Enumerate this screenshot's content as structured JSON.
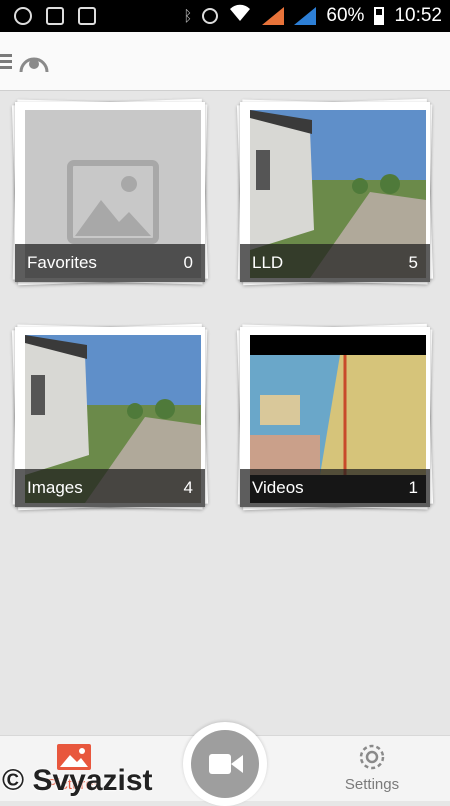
{
  "status_bar": {
    "battery": "60%",
    "time": "10:52",
    "left_icons": [
      "search-status-icon",
      "image-status-icon",
      "shield-status-icon"
    ],
    "right_icons": [
      "bluetooth-icon",
      "alarm-icon",
      "wifi-icon",
      "signal-icon",
      "signal-icon",
      "battery-icon"
    ]
  },
  "app_bar": {
    "icons": [
      "menu-icon",
      "app-logo-icon"
    ]
  },
  "albums": [
    {
      "label": "Favorites",
      "count": "0",
      "thumbnail": "placeholder-image-icon"
    },
    {
      "label": "LLD",
      "count": "5",
      "thumbnail": "road-photo"
    },
    {
      "label": "Images",
      "count": "4",
      "thumbnail": "road-photo"
    },
    {
      "label": "Videos",
      "count": "1",
      "thumbnail": "device-photo"
    }
  ],
  "bottom_nav": {
    "pictures_label": "Pictures",
    "settings_label": "Settings",
    "record_icon": "video-camera-icon"
  },
  "watermark": "© Svyazist",
  "colors": {
    "accent": "#e8573d",
    "background": "#e6e6e6",
    "caption_bg": "#1e1e1e"
  }
}
